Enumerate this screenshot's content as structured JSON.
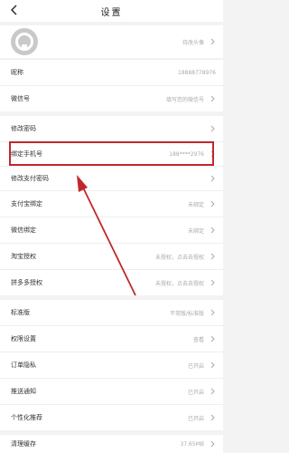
{
  "header": {
    "title": "设置"
  },
  "profile": {
    "value": "待改头像"
  },
  "groups": [
    [
      {
        "key": "nickname",
        "label": "昵称",
        "value": "18888778976",
        "chevron": false
      },
      {
        "key": "wechat",
        "label": "微信号",
        "value": "填写您的微信号",
        "chevron": true
      }
    ],
    [
      {
        "key": "login-password",
        "label": "修改密码",
        "value": "",
        "chevron": true
      },
      {
        "key": "bind-phone",
        "label": "绑定手机号",
        "value": "188****2976",
        "chevron": true
      },
      {
        "key": "pay-password",
        "label": "修改支付密码",
        "value": "",
        "chevron": true
      },
      {
        "key": "alipay",
        "label": "支付宝绑定",
        "value": "未绑定",
        "chevron": true
      },
      {
        "key": "wechat-bind",
        "label": "微信绑定",
        "value": "未绑定",
        "chevron": true
      },
      {
        "key": "taobao",
        "label": "淘宝授权",
        "value": "未授权，点去去授权",
        "chevron": true
      },
      {
        "key": "pinduoduo",
        "label": "拼多多授权",
        "value": "未授权，点去去授权",
        "chevron": true
      }
    ],
    [
      {
        "key": "standard",
        "label": "标准版",
        "value": "不常版/标准版",
        "chevron": true
      },
      {
        "key": "permissions",
        "label": "权限设置",
        "value": "查看",
        "chevron": true
      },
      {
        "key": "order-privacy",
        "label": "订单隐私",
        "value": "已开启",
        "chevron": true
      },
      {
        "key": "push",
        "label": "推送通知",
        "value": "已开启",
        "chevron": true
      },
      {
        "key": "personalized",
        "label": "个性化推荐",
        "value": "已开启",
        "chevron": true
      }
    ],
    [
      {
        "key": "cache",
        "label": "清理缓存",
        "value": "37.65MB",
        "chevron": true
      }
    ]
  ],
  "icons": {
    "back": "back-arrow-icon",
    "chevron": "chevron-right-icon",
    "avatar": "default-avatar-icon"
  },
  "colors": {
    "highlight": "#c0282b",
    "background": "#f3f3f3",
    "row": "#ffffff"
  }
}
